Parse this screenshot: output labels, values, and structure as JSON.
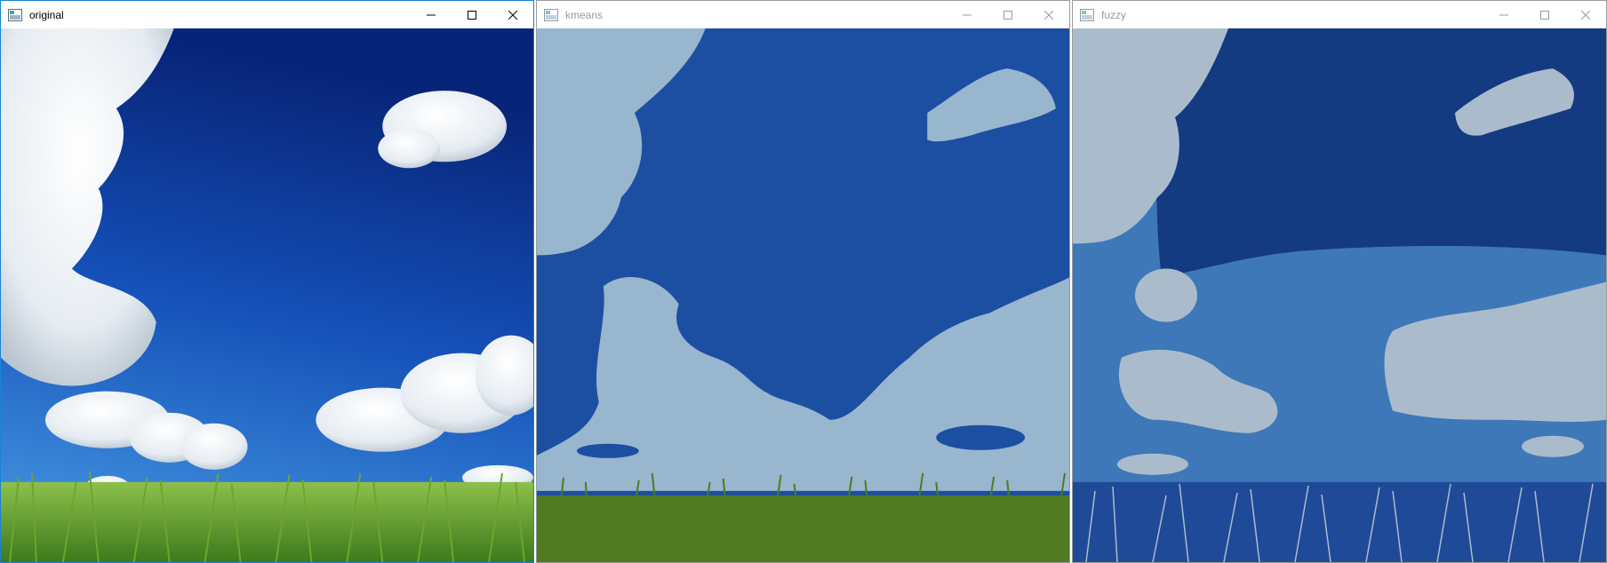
{
  "windows": [
    {
      "title": "original",
      "image": "original sky photograph"
    },
    {
      "title": "kmeans",
      "image": "k-means segmentation result"
    },
    {
      "title": "fuzzy",
      "image": "fuzzy c-means segmentation result"
    }
  ],
  "icons": {
    "app": "opencv-window-icon",
    "minimize": "minimize-icon",
    "maximize": "maximize-icon",
    "close": "close-icon"
  },
  "colors": {
    "active_border": "#1883d7",
    "inactive_border": "#9a9a9a",
    "sky_dark": "#0a2a8a",
    "sky_light": "#3d8fe0",
    "cloud_white": "#ffffff",
    "grass_green": "#5d9a2c",
    "kmeans_sky": "#1c4ea2",
    "kmeans_cloud": "#98b6cd",
    "kmeans_grass": "#4f7a22",
    "fuzzy_sky_dark": "#143a82",
    "fuzzy_sky_mid": "#3e78b8",
    "fuzzy_cloud": "#aabccc",
    "fuzzy_grass": "#1e4a98"
  }
}
